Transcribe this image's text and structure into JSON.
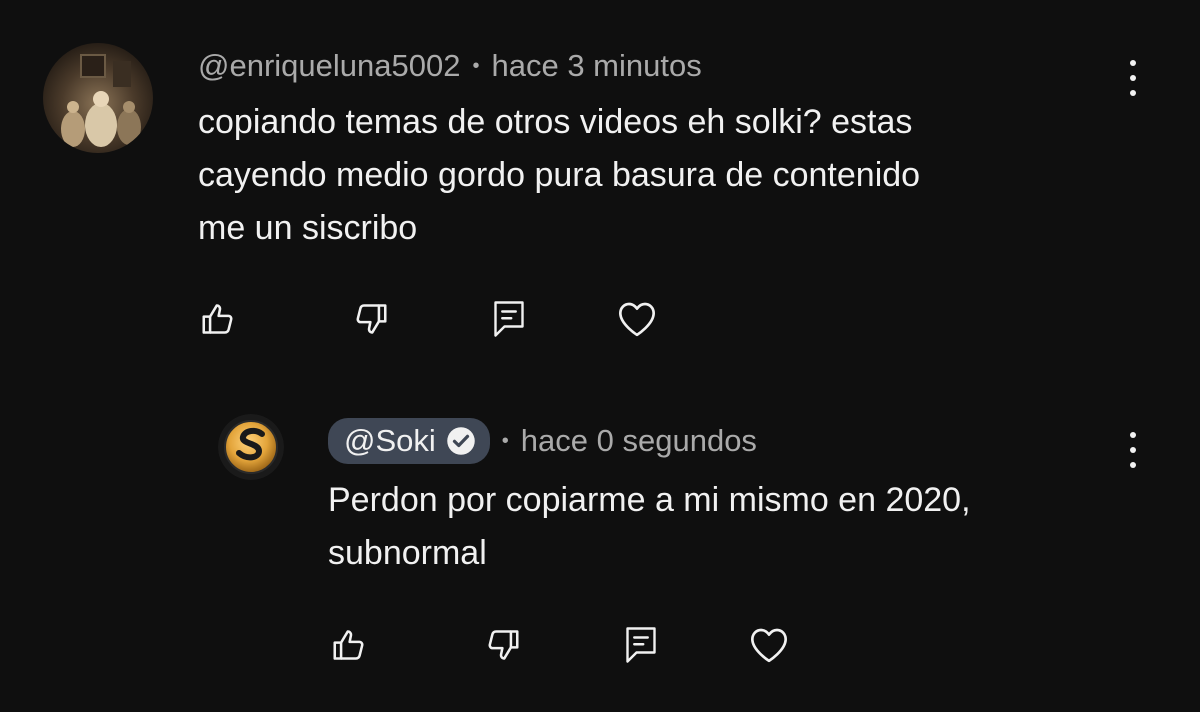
{
  "comment": {
    "username": "@enriqueluna5002",
    "separator": "•",
    "time": "hace 3 minutos",
    "text": "copiando temas de otros videos eh solki? estas\ncayendo medio gordo pura basura de contenido\nme un siscribo",
    "actions": [
      "like-icon",
      "dislike-icon",
      "reply-icon",
      "heart-icon"
    ]
  },
  "reply": {
    "username": "@Soki",
    "verified": true,
    "separator": "•",
    "time": "hace 0 segundos",
    "text": "Perdon por copiarme a mi mismo en 2020,\nsubnormal",
    "actions": [
      "like-icon",
      "dislike-icon",
      "reply-icon",
      "heart-icon"
    ]
  },
  "colors": {
    "background": "#0f0f0f",
    "text_primary": "#f1f1f1",
    "text_secondary": "#aaaaaa",
    "creator_chip": "#3f4755",
    "logo_gold": "#e3a43a"
  }
}
